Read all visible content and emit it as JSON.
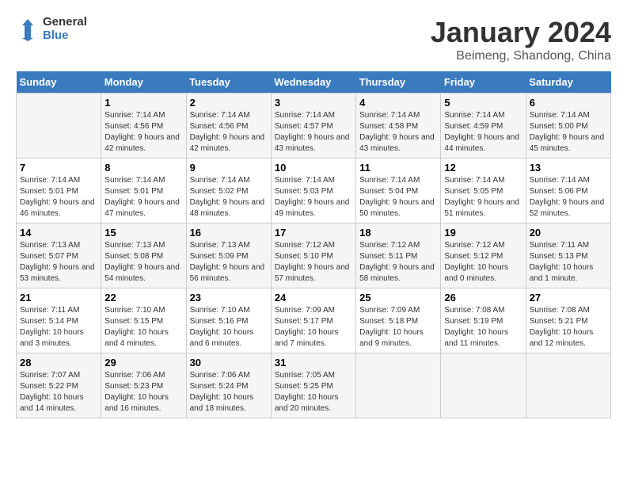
{
  "logo": {
    "general": "General",
    "blue": "Blue"
  },
  "title": "January 2024",
  "subtitle": "Beimeng, Shandong, China",
  "days_of_week": [
    "Sunday",
    "Monday",
    "Tuesday",
    "Wednesday",
    "Thursday",
    "Friday",
    "Saturday"
  ],
  "weeks": [
    [
      {
        "day": "",
        "info": ""
      },
      {
        "day": "1",
        "sunrise": "7:14 AM",
        "sunset": "4:56 PM",
        "daylight": "9 hours and 42 minutes."
      },
      {
        "day": "2",
        "sunrise": "7:14 AM",
        "sunset": "4:56 PM",
        "daylight": "9 hours and 42 minutes."
      },
      {
        "day": "3",
        "sunrise": "7:14 AM",
        "sunset": "4:57 PM",
        "daylight": "9 hours and 43 minutes."
      },
      {
        "day": "4",
        "sunrise": "7:14 AM",
        "sunset": "4:58 PM",
        "daylight": "9 hours and 43 minutes."
      },
      {
        "day": "5",
        "sunrise": "7:14 AM",
        "sunset": "4:59 PM",
        "daylight": "9 hours and 44 minutes."
      },
      {
        "day": "6",
        "sunrise": "7:14 AM",
        "sunset": "5:00 PM",
        "daylight": "9 hours and 45 minutes."
      }
    ],
    [
      {
        "day": "7",
        "sunrise": "7:14 AM",
        "sunset": "5:01 PM",
        "daylight": "9 hours and 46 minutes."
      },
      {
        "day": "8",
        "sunrise": "7:14 AM",
        "sunset": "5:01 PM",
        "daylight": "9 hours and 47 minutes."
      },
      {
        "day": "9",
        "sunrise": "7:14 AM",
        "sunset": "5:02 PM",
        "daylight": "9 hours and 48 minutes."
      },
      {
        "day": "10",
        "sunrise": "7:14 AM",
        "sunset": "5:03 PM",
        "daylight": "9 hours and 49 minutes."
      },
      {
        "day": "11",
        "sunrise": "7:14 AM",
        "sunset": "5:04 PM",
        "daylight": "9 hours and 50 minutes."
      },
      {
        "day": "12",
        "sunrise": "7:14 AM",
        "sunset": "5:05 PM",
        "daylight": "9 hours and 51 minutes."
      },
      {
        "day": "13",
        "sunrise": "7:14 AM",
        "sunset": "5:06 PM",
        "daylight": "9 hours and 52 minutes."
      }
    ],
    [
      {
        "day": "14",
        "sunrise": "7:13 AM",
        "sunset": "5:07 PM",
        "daylight": "9 hours and 53 minutes."
      },
      {
        "day": "15",
        "sunrise": "7:13 AM",
        "sunset": "5:08 PM",
        "daylight": "9 hours and 54 minutes."
      },
      {
        "day": "16",
        "sunrise": "7:13 AM",
        "sunset": "5:09 PM",
        "daylight": "9 hours and 56 minutes."
      },
      {
        "day": "17",
        "sunrise": "7:12 AM",
        "sunset": "5:10 PM",
        "daylight": "9 hours and 57 minutes."
      },
      {
        "day": "18",
        "sunrise": "7:12 AM",
        "sunset": "5:11 PM",
        "daylight": "9 hours and 58 minutes."
      },
      {
        "day": "19",
        "sunrise": "7:12 AM",
        "sunset": "5:12 PM",
        "daylight": "10 hours and 0 minutes."
      },
      {
        "day": "20",
        "sunrise": "7:11 AM",
        "sunset": "5:13 PM",
        "daylight": "10 hours and 1 minute."
      }
    ],
    [
      {
        "day": "21",
        "sunrise": "7:11 AM",
        "sunset": "5:14 PM",
        "daylight": "10 hours and 3 minutes."
      },
      {
        "day": "22",
        "sunrise": "7:10 AM",
        "sunset": "5:15 PM",
        "daylight": "10 hours and 4 minutes."
      },
      {
        "day": "23",
        "sunrise": "7:10 AM",
        "sunset": "5:16 PM",
        "daylight": "10 hours and 6 minutes."
      },
      {
        "day": "24",
        "sunrise": "7:09 AM",
        "sunset": "5:17 PM",
        "daylight": "10 hours and 7 minutes."
      },
      {
        "day": "25",
        "sunrise": "7:09 AM",
        "sunset": "5:18 PM",
        "daylight": "10 hours and 9 minutes."
      },
      {
        "day": "26",
        "sunrise": "7:08 AM",
        "sunset": "5:19 PM",
        "daylight": "10 hours and 11 minutes."
      },
      {
        "day": "27",
        "sunrise": "7:08 AM",
        "sunset": "5:21 PM",
        "daylight": "10 hours and 12 minutes."
      }
    ],
    [
      {
        "day": "28",
        "sunrise": "7:07 AM",
        "sunset": "5:22 PM",
        "daylight": "10 hours and 14 minutes."
      },
      {
        "day": "29",
        "sunrise": "7:06 AM",
        "sunset": "5:23 PM",
        "daylight": "10 hours and 16 minutes."
      },
      {
        "day": "30",
        "sunrise": "7:06 AM",
        "sunset": "5:24 PM",
        "daylight": "10 hours and 18 minutes."
      },
      {
        "day": "31",
        "sunrise": "7:05 AM",
        "sunset": "5:25 PM",
        "daylight": "10 hours and 20 minutes."
      },
      {
        "day": "",
        "info": ""
      },
      {
        "day": "",
        "info": ""
      },
      {
        "day": "",
        "info": ""
      }
    ]
  ],
  "labels": {
    "sunrise": "Sunrise:",
    "sunset": "Sunset:",
    "daylight": "Daylight:"
  }
}
